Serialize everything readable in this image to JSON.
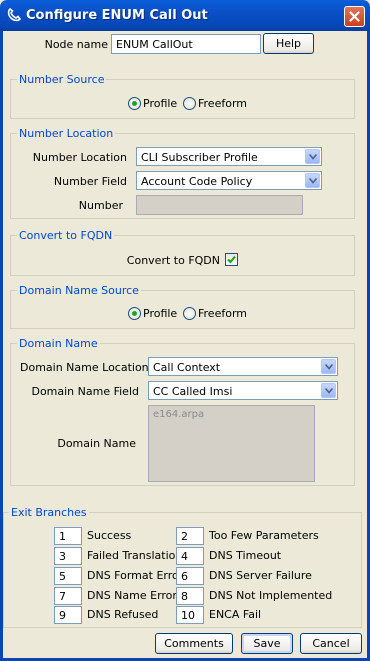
{
  "window": {
    "title": "Configure ENUM Call Out",
    "close_icon": "close-icon",
    "colors": {
      "titlebar": "#0a4fc6",
      "legend_text": "#0046d5",
      "background": "#ece9d8"
    }
  },
  "node": {
    "label": "Node name",
    "value": "ENUM CallOut",
    "help_label": "Help"
  },
  "number_source": {
    "legend": "Number Source",
    "options": [
      {
        "label": "Profile",
        "selected": true
      },
      {
        "label": "Freeform",
        "selected": false
      }
    ]
  },
  "number_location": {
    "legend": "Number Location",
    "location_label": "Number Location",
    "location_value": "CLI Subscriber Profile",
    "field_label": "Number Field",
    "field_value": "Account Code Policy",
    "number_label": "Number",
    "number_value": ""
  },
  "convert_fqdn": {
    "legend": "Convert to FQDN",
    "label": "Convert to FQDN",
    "checked": true
  },
  "domain_name_source": {
    "legend": "Domain Name Source",
    "options": [
      {
        "label": "Profile",
        "selected": true
      },
      {
        "label": "Freeform",
        "selected": false
      }
    ]
  },
  "domain_name": {
    "legend": "Domain Name",
    "location_label": "Domain Name Location",
    "location_value": "Call Context",
    "field_label": "Domain Name Field",
    "field_value": "CC Called Imsi",
    "name_label": "Domain Name",
    "name_value": "e164.arpa"
  },
  "exit_branches": {
    "legend": "Exit Branches",
    "items": [
      {
        "id": "1",
        "name": "Success"
      },
      {
        "id": "2",
        "name": "Too Few Parameters"
      },
      {
        "id": "3",
        "name": "Failed Translation"
      },
      {
        "id": "4",
        "name": "DNS Timeout"
      },
      {
        "id": "5",
        "name": "DNS Format Error"
      },
      {
        "id": "6",
        "name": "DNS Server Failure"
      },
      {
        "id": "7",
        "name": "DNS Name Error"
      },
      {
        "id": "8",
        "name": "DNS Not Implemented"
      },
      {
        "id": "9",
        "name": "DNS Refused"
      },
      {
        "id": "10",
        "name": "ENCA Fail"
      }
    ]
  },
  "footer": {
    "comments_label": "Comments",
    "save_label": "Save",
    "cancel_label": "Cancel"
  }
}
